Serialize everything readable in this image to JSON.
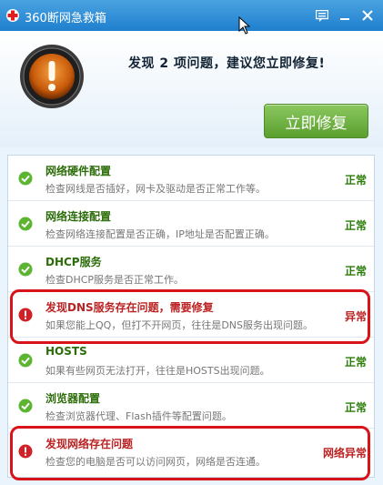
{
  "window": {
    "title": "360断网急救箱"
  },
  "header": {
    "headline": "发现 2 项问题，建议您立即修复!",
    "fix_button": "立即修复"
  },
  "colors": {
    "title_bar": "#2a8ad6",
    "ok_text": "#2c7d0a",
    "error_text": "#bb2222",
    "highlight": "#d9131a",
    "button": "#6aaf3d"
  },
  "items": [
    {
      "name": "网络硬件配置",
      "desc": "检查网线是否插好，网卡及驱动是否正常工作等。",
      "status": "正常",
      "icon": "check-icon",
      "state": "ok"
    },
    {
      "name": "网络连接配置",
      "desc": "检查网络连接配置是否正确，IP地址是否配置正确。",
      "status": "正常",
      "icon": "check-icon",
      "state": "ok"
    },
    {
      "name": "DHCP服务",
      "desc": "检查DHCP服务是否正常工作。",
      "status": "正常",
      "icon": "check-icon",
      "state": "ok"
    },
    {
      "name": "发现DNS服务存在问题，需要修复",
      "desc": "如果您能上QQ，但打不开网页，往往是DNS服务出现问题。",
      "status": "异常",
      "icon": "error-icon",
      "state": "error"
    },
    {
      "name": "HOSTS",
      "desc": "如果有些网页无法打开，往往是HOSTS出现问题。",
      "status": "正常",
      "icon": "check-icon",
      "state": "ok"
    },
    {
      "name": "浏览器配置",
      "desc": "检查浏览器代理、Flash插件等配置问题。",
      "status": "正常",
      "icon": "check-icon",
      "state": "ok"
    },
    {
      "name": "发现网络存在问题",
      "desc": "检查您的电脑是否可以访问网页，网络是否连通。",
      "status": "网络异常",
      "icon": "error-icon",
      "state": "error"
    }
  ]
}
